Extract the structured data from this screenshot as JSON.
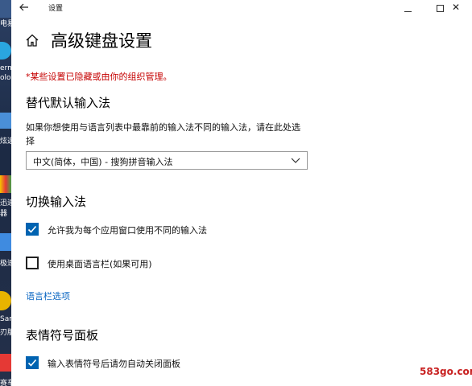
{
  "desktop": {
    "labels": [
      "电易",
      "erm",
      "olo",
      "炫选",
      "迅速",
      "器",
      "极速",
      "Sam",
      "刃版",
      "赛车游"
    ]
  },
  "window": {
    "title": "设置",
    "back_icon": "back-arrow-icon",
    "close_glyph": "✕"
  },
  "page": {
    "title": "高级键盘设置",
    "warning": "*某些设置已隐藏或由你的组织管理。",
    "accent_color": "#0063b1",
    "warning_color": "#c50000"
  },
  "override": {
    "heading": "替代默认输入法",
    "description": "如果你想使用与语言列表中最靠前的输入法不同的输入法，请在此处选择",
    "selected": "中文(简体，中国) - 搜狗拼音输入法"
  },
  "switching": {
    "heading": "切换输入法",
    "per_app_label": "允许我为每个应用窗口使用不同的输入法",
    "per_app_checked": true,
    "langbar_label": "使用桌面语言栏(如果可用)",
    "langbar_checked": false,
    "link": "语言栏选项"
  },
  "emoji": {
    "heading": "表情符号面板",
    "autoclose_label": "输入表情符号后请勿自动关闭面板",
    "autoclose_checked": true
  },
  "watermark": "583go.com"
}
